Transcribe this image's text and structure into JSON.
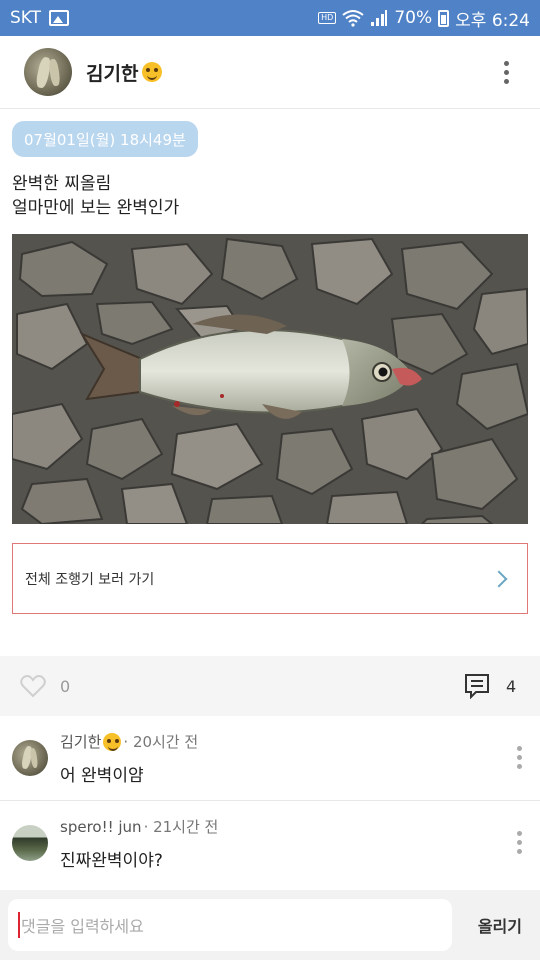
{
  "status": {
    "carrier": "SKT",
    "hd_label": "HD",
    "battery": "70%",
    "time": "오후 6:24"
  },
  "header": {
    "author": "김기한",
    "author_emoji": "grinning-face-emoji"
  },
  "post": {
    "date": "07월01일(월) 18시49분",
    "text_line1": "완벽한 찌올림",
    "text_line2": "얼마만에 보는 완벽인가",
    "photo": "fish-on-gravel-photo"
  },
  "link": {
    "label": "전체 조행기 보러 가기"
  },
  "actions": {
    "like_count": "0",
    "comment_count": "4"
  },
  "comments": [
    {
      "author": "김기한",
      "time": "· 20시간 전",
      "body": "어 완벽이얌"
    },
    {
      "author": "spero!! jun",
      "time": "· 21시간 전",
      "body": "진짜완벽이야?"
    }
  ],
  "input": {
    "placeholder": "댓글을 입력하세요",
    "send_label": "올리기"
  },
  "colors": {
    "status_bar": "#4f82c6",
    "date_badge": "#b9d6ef",
    "link_border": "#e07878"
  }
}
